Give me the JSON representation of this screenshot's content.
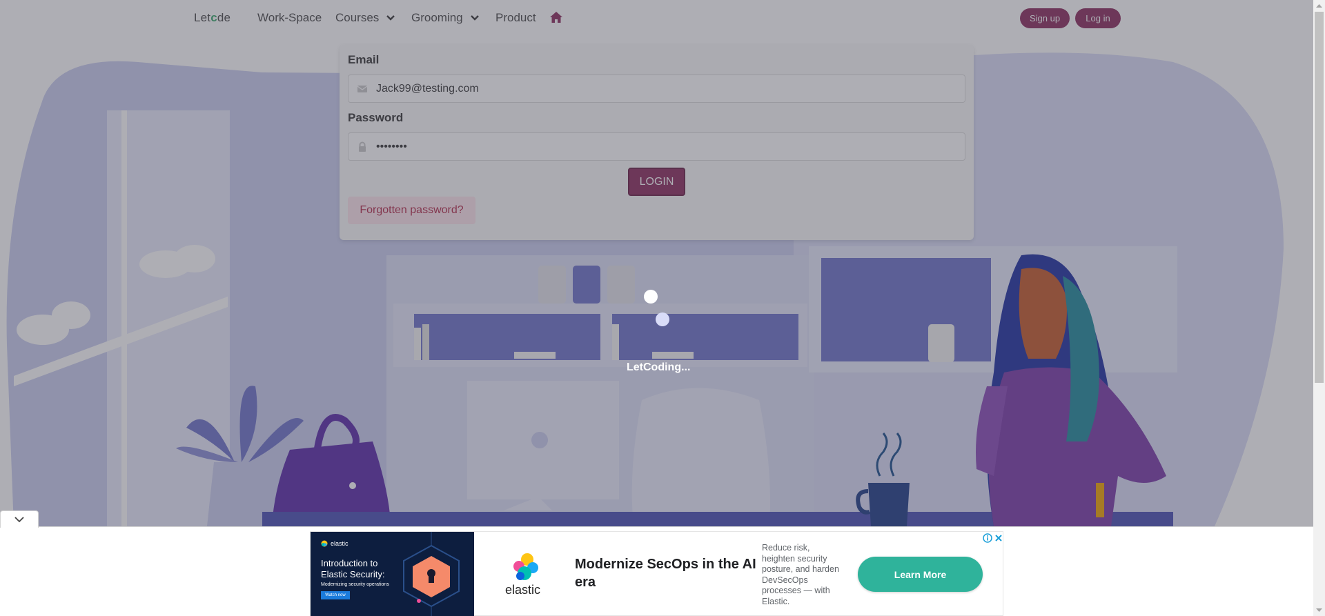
{
  "nav": {
    "brand_prefix": "Let",
    "brand_o": "c",
    "brand_suffix": "de",
    "items": [
      {
        "label": "Work-Space"
      },
      {
        "label": "Courses"
      },
      {
        "label": "Grooming"
      },
      {
        "label": "Product"
      }
    ],
    "home_icon": "home-icon",
    "signup_label": "Sign up",
    "login_label": "Log in"
  },
  "login_form": {
    "email_label": "Email",
    "email_value": "Jack99@testing.com",
    "email_icon": "envelope-icon",
    "password_label": "Password",
    "password_value": "••••••••",
    "password_icon": "lock-icon",
    "submit_label": "LOGIN",
    "forgot_label": "Forgotten password?"
  },
  "loading": {
    "text": "LetCoding..."
  },
  "ad": {
    "image_brand": "elastic",
    "image_headline": "Introduction to Elastic Security:",
    "image_subline": "Modernizing security operations",
    "image_button": "Watch now",
    "logo_text": "elastic",
    "headline": "Modernize SecOps in the AI era",
    "body": "Reduce risk, heighten security posture, and harden DevSecOps processes — with Elastic.",
    "cta": "Learn More"
  },
  "colors": {
    "accent": "#8b2c5d",
    "forgot_bg": "#fde5ec",
    "forgot_text": "#b32a4a",
    "cta": "#2fb39b",
    "overlay": "#464655"
  }
}
